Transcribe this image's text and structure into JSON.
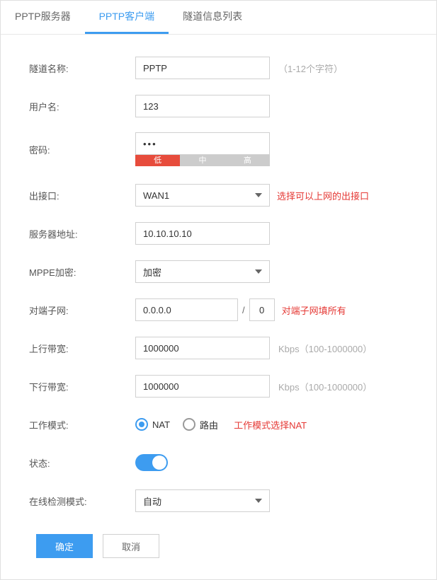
{
  "tabs": {
    "server": "PPTP服务器",
    "client": "PPTP客户端",
    "tunnel_list": "隧道信息列表"
  },
  "form": {
    "tunnel_name": {
      "label": "隧道名称:",
      "value": "PPTP",
      "hint": "（1-12个字符）"
    },
    "username": {
      "label": "用户名:",
      "value": "123"
    },
    "password": {
      "label": "密码:",
      "value": "•••"
    },
    "strength": {
      "low": "低",
      "mid": "中",
      "high": "高"
    },
    "out_interface": {
      "label": "出接口:",
      "value": "WAN1",
      "note": "选择可以上网的出接口"
    },
    "server_addr": {
      "label": "服务器地址:",
      "value": "10.10.10.10"
    },
    "mppe": {
      "label": "MPPE加密:",
      "value": "加密"
    },
    "peer_subnet": {
      "label": "对端子网:",
      "value": "0.0.0.0",
      "mask": "0",
      "note": "对端子网填所有"
    },
    "up_bw": {
      "label": "上行带宽:",
      "value": "1000000",
      "hint": "Kbps（100-1000000）"
    },
    "down_bw": {
      "label": "下行带宽:",
      "value": "1000000",
      "hint": "Kbps（100-1000000）"
    },
    "mode": {
      "label": "工作模式:",
      "nat": "NAT",
      "route": "路由",
      "note": "工作模式选择NAT"
    },
    "status": {
      "label": "状态:"
    },
    "detect": {
      "label": "在线检测模式:",
      "value": "自动"
    }
  },
  "buttons": {
    "ok": "确定",
    "cancel": "取消"
  }
}
